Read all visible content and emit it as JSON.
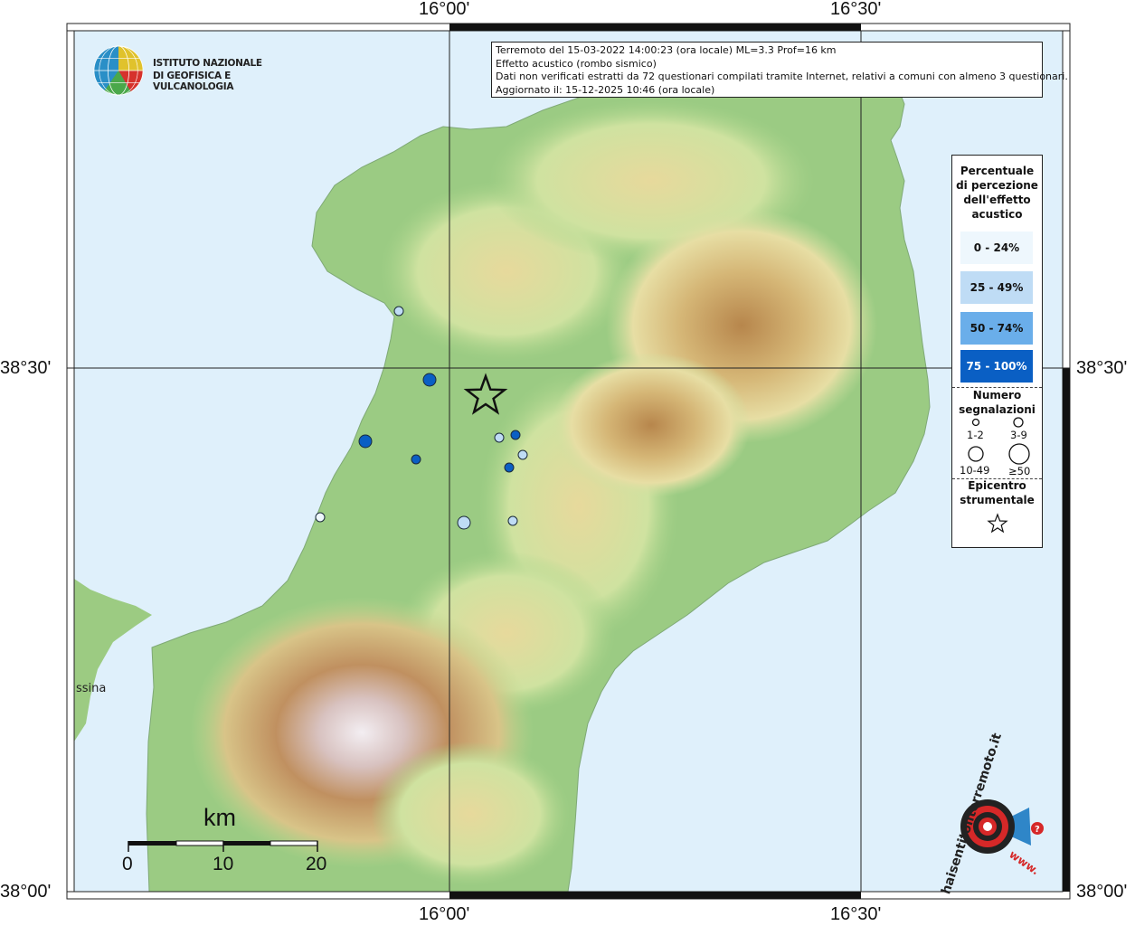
{
  "event_info": {
    "line1": "Terremoto del 15-03-2022 14:00:23 (ora locale) ML=3.3 Prof=16 km",
    "line2": "Effetto acustico (rombo sismico)",
    "line3": "Dati non verificati estratti da 72 questionari compilati tramite Internet, relativi a comuni con almeno 3 questionari.",
    "line4": "Aggiornato il: 15-12-2025 10:46 (ora locale)"
  },
  "ingv_logo": {
    "line1": "ISTITUTO NAZIONALE",
    "line2": "DI GEOFISICA E VULCANOLOGIA"
  },
  "coordinates": {
    "top_left_lon": "16°00'",
    "top_right_lon": "16°30'",
    "bottom_left_lon": "16°00'",
    "bottom_right_lon": "16°30'",
    "left_top_lat": "38°30'",
    "left_bottom_lat": "38°00'",
    "right_top_lat": "38°30'",
    "right_bottom_lat": "38°00'"
  },
  "place_label": "ssina",
  "legend": {
    "title": [
      "Percentuale",
      "di percezione",
      "dell'effetto",
      "acustico"
    ],
    "classes": [
      {
        "label": "0 - 24%",
        "color": "#eef7fd",
        "text_color": "#111111"
      },
      {
        "label": "25 - 49%",
        "color": "#bfdcf5",
        "text_color": "#111111"
      },
      {
        "label": "50 - 74%",
        "color": "#6aaeea",
        "text_color": "#111111"
      },
      {
        "label": "75 - 100%",
        "color": "#0a5fc4",
        "text_color": "#ffffff"
      }
    ],
    "count_title": [
      "Numero",
      "segnalazioni"
    ],
    "count_classes": [
      "1-2",
      "3-9",
      "10-49",
      "≥50"
    ],
    "epicenter_title": [
      "Epicentro",
      "strumentale"
    ],
    "epicenter_icon": "star-icon"
  },
  "scale_bar": {
    "unit": "km",
    "ticks": [
      "0",
      "10",
      "20"
    ]
  },
  "hsit_logo": {
    "text": "haisentitoilterremoto.it",
    "www": "www.",
    "icon": "target-megaphone-icon"
  },
  "colors": {
    "sea": "#dff0fb",
    "land_low": "#8fc47a",
    "land_mid": "#e6dca0",
    "land_high": "#c49a5c",
    "frame": "#111111"
  },
  "observations": [
    {
      "class": 1,
      "count": "3-9"
    },
    {
      "class": 3,
      "count": "10-49"
    },
    {
      "class": 3,
      "count": "10-49"
    },
    {
      "class": 3,
      "count": "3-9"
    },
    {
      "class": 1,
      "count": "3-9"
    },
    {
      "class": 3,
      "count": "3-9"
    },
    {
      "class": 1,
      "count": "3-9"
    },
    {
      "class": 3,
      "count": "3-9"
    },
    {
      "class": 0,
      "count": "3-9"
    },
    {
      "class": 1,
      "count": "10-49"
    },
    {
      "class": 1,
      "count": "3-9"
    }
  ]
}
